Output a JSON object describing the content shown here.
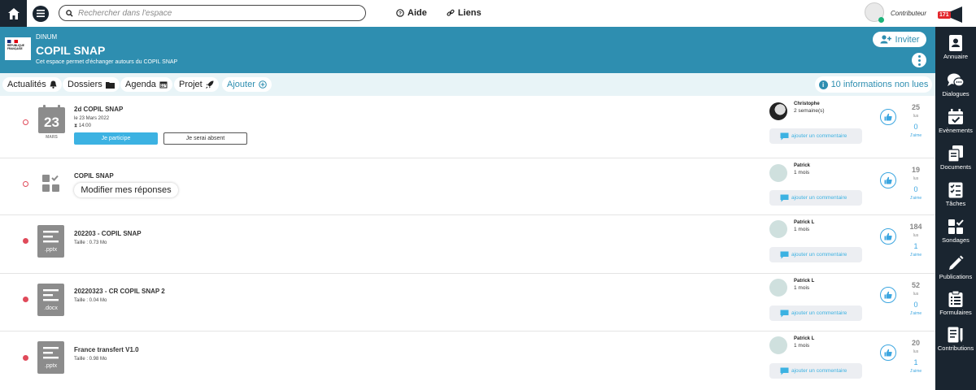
{
  "topbar": {
    "search_placeholder": "Rechercher dans l'espace",
    "help_label": "Aide",
    "links_label": "Liens",
    "user_role": "Contributeur",
    "notif_count": "171"
  },
  "header": {
    "logo_text": "RÉPUBLIQUE FRANÇAISE",
    "org": "DINUM",
    "title": "COPIL SNAP",
    "description": "Cet espace permet d'échanger autours du COPIL SNAP",
    "invite_label": "Inviter"
  },
  "tabs": {
    "actualites": "Actualités",
    "dossiers": "Dossiers",
    "agenda": "Agenda",
    "projet": "Projet",
    "ajouter": "Ajouter",
    "info": "10 informations non lues"
  },
  "feed": {
    "comment_label": "ajouter un commentaire",
    "lus_label": "lus",
    "jaime_label": "J'aime",
    "event": {
      "day": "23",
      "month": "MARS",
      "title": "2d COPIL SNAP",
      "date": "le 23 Mars 2022",
      "time": "14:00",
      "participate_label": "Je participe",
      "absent_label": "Je serai absent",
      "author": "Christophe",
      "when": "2 semaine(s)",
      "views": "25",
      "likes": "0"
    },
    "survey": {
      "title": "COPIL SNAP",
      "button_label": "Modifier mes réponses",
      "author": "Patrick",
      "when": "1 mois",
      "views": "19",
      "likes": "0"
    },
    "doc1": {
      "title": "202203 - COPIL SNAP",
      "size": "Taille : 0.73 Mo",
      "ext": ".pptx",
      "author": "Patrick L",
      "when": "1 mois",
      "views": "184",
      "likes": "1"
    },
    "doc2": {
      "title": "20220323 - CR COPIL SNAP 2",
      "size": "Taille : 0.04 Mo",
      "ext": ".docx",
      "author": "Patrick L",
      "when": "1 mois",
      "views": "52",
      "likes": "0"
    },
    "doc3": {
      "title": "France transfert V1.0",
      "size": "Taille : 0.98 Mo",
      "ext": ".pptx",
      "author": "Patrick L",
      "when": "1 mois",
      "views": "20",
      "likes": "1"
    }
  },
  "sidebar": {
    "items": [
      {
        "label": "Annuaire",
        "icon": "address-book-icon"
      },
      {
        "label": "Dialogues",
        "icon": "chat-icon"
      },
      {
        "label": "Evènements",
        "icon": "calendar-check-icon"
      },
      {
        "label": "Documents",
        "icon": "documents-icon"
      },
      {
        "label": "Tâches",
        "icon": "tasks-icon"
      },
      {
        "label": "Sondages",
        "icon": "poll-icon"
      },
      {
        "label": "Publications",
        "icon": "pencil-icon"
      },
      {
        "label": "Formulaires",
        "icon": "form-icon"
      },
      {
        "label": "Contributions",
        "icon": "contributions-icon"
      }
    ]
  },
  "colors": {
    "banner": "#2e8eb0",
    "sidebar": "#1a2530",
    "accent": "#3cb2e2",
    "status": "#e04a5a"
  }
}
